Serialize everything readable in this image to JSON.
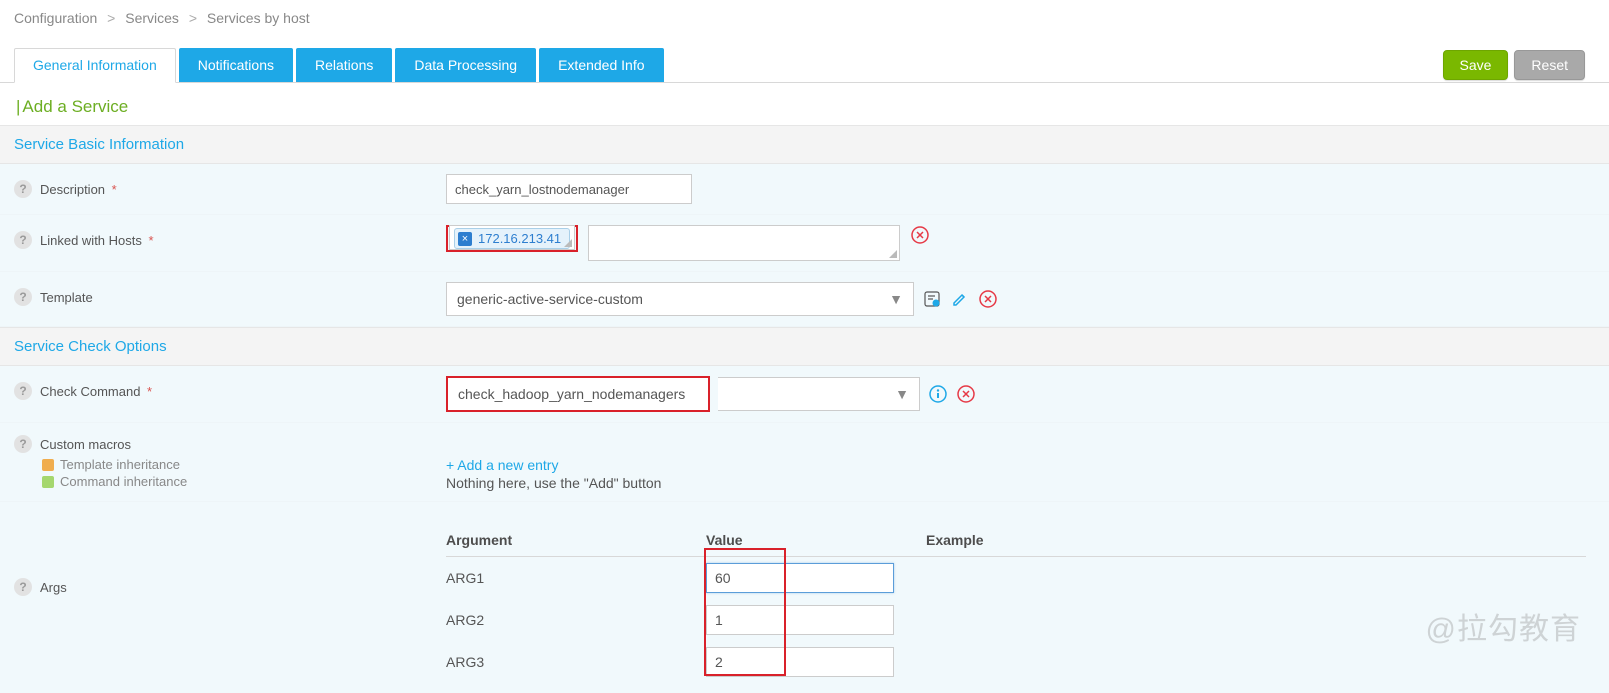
{
  "breadcrumb": {
    "a": "Configuration",
    "b": "Services",
    "c": "Services by host"
  },
  "tabs": {
    "general": "General Information",
    "notifications": "Notifications",
    "relations": "Relations",
    "data_processing": "Data Processing",
    "extended": "Extended Info"
  },
  "buttons": {
    "save": "Save",
    "reset": "Reset"
  },
  "title": "Add a Service",
  "sections": {
    "basic": "Service Basic Information",
    "check": "Service Check Options"
  },
  "labels": {
    "description": "Description",
    "linked_hosts": "Linked with Hosts",
    "template": "Template",
    "check_command": "Check Command",
    "custom_macros": "Custom macros",
    "template_inherit": "Template inheritance",
    "command_inherit": "Command inheritance",
    "args": "Args"
  },
  "values": {
    "description": "check_yarn_lostnodemanager",
    "host_tag": "172.16.213.41",
    "template": "generic-active-service-custom",
    "check_command": "check_hadoop_yarn_nodemanagers"
  },
  "macros": {
    "add_link": "+ Add a new entry",
    "empty_text": "Nothing here, use the \"Add\" button"
  },
  "args_table": {
    "headers": {
      "argument": "Argument",
      "value": "Value",
      "example": "Example"
    },
    "rows": [
      {
        "name": "ARG1",
        "value": "60",
        "example": ""
      },
      {
        "name": "ARG2",
        "value": "1",
        "example": ""
      },
      {
        "name": "ARG3",
        "value": "2",
        "example": ""
      }
    ]
  },
  "watermark": "@拉勾教育"
}
